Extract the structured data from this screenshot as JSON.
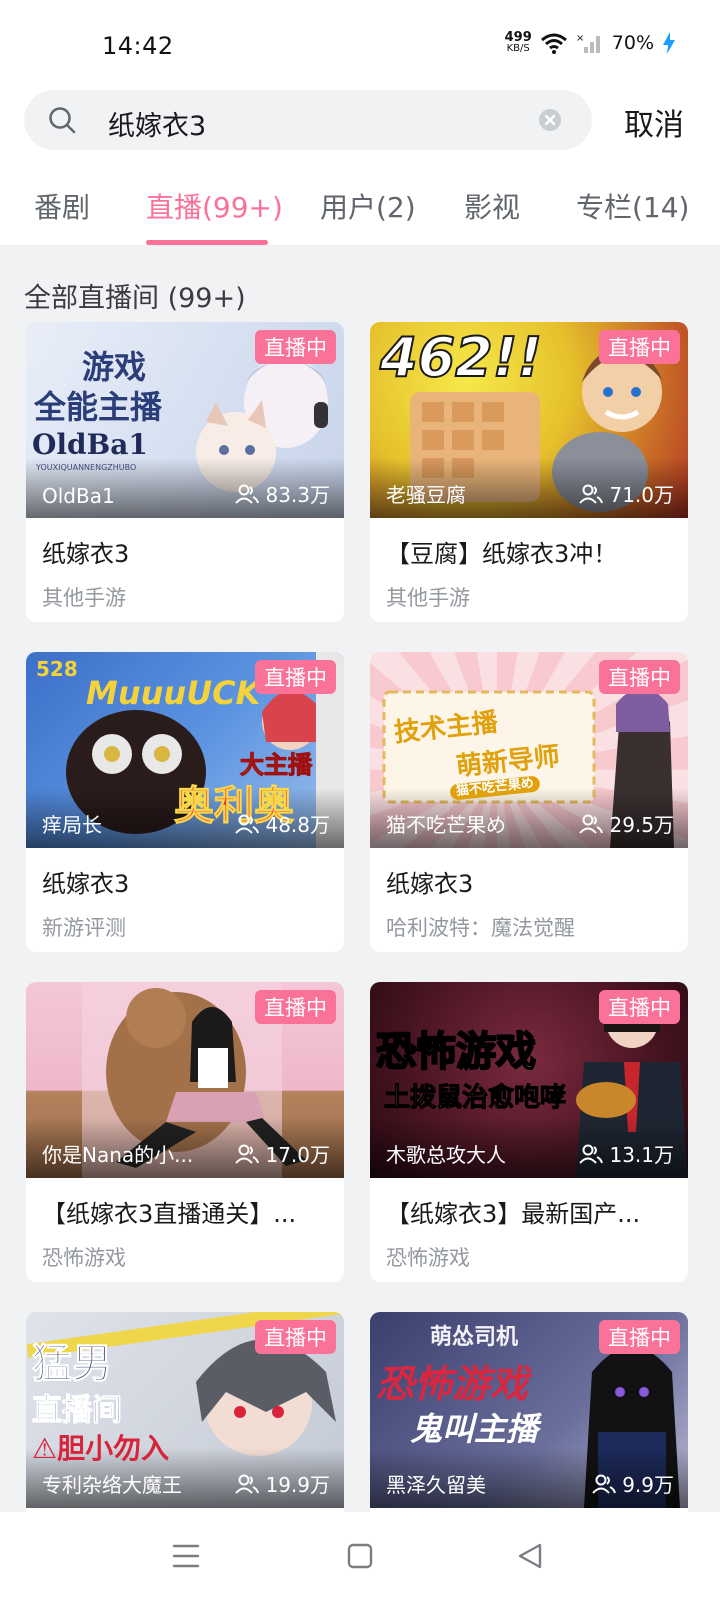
{
  "status": {
    "time": "14:42",
    "speed_value": "499",
    "speed_unit": "KB/S",
    "battery": "70%"
  },
  "search": {
    "query": "纸嫁衣3",
    "cancel_label": "取消"
  },
  "tabs": [
    {
      "label": "番剧"
    },
    {
      "label": "直播(99+)"
    },
    {
      "label": "用户(2)"
    },
    {
      "label": "影视"
    },
    {
      "label": "专栏(14)"
    }
  ],
  "section_title": "全部直播间 (99+)",
  "live_badge": "直播中",
  "cards": [
    {
      "anchor": "OldBa1",
      "viewers": "83.3万",
      "title": "纸嫁衣3",
      "category": "其他手游",
      "thumb_lines": [
        "游戏",
        "全能主播",
        "OldBa1"
      ],
      "thumb_sub": "YOUXIQUANNENGZHUBO"
    },
    {
      "anchor": "老骚豆腐",
      "viewers": "71.0万",
      "title": "【豆腐】纸嫁衣3冲！",
      "category": "其他手游",
      "thumb_lines": [
        "462!!"
      ]
    },
    {
      "anchor": "痒局长",
      "viewers": "48.8万",
      "title": "纸嫁衣3",
      "category": "新游评测",
      "thumb_lines": [
        "528",
        "MuuuUCK",
        "大主播",
        "奥利奥"
      ]
    },
    {
      "anchor": "猫不吃芒果め",
      "viewers": "29.5万",
      "title": "纸嫁衣3",
      "category": "哈利波特：魔法觉醒",
      "thumb_lines": [
        "技术主播",
        "萌新导师",
        "猫不吃芒果め"
      ]
    },
    {
      "anchor": "你是Nana的小...",
      "viewers": "17.0万",
      "title": "【纸嫁衣3直播通关】...",
      "category": "恐怖游戏"
    },
    {
      "anchor": "木歌总攻大人",
      "viewers": "13.1万",
      "title": "【纸嫁衣3】最新国产...",
      "category": "恐怖游戏",
      "thumb_lines": [
        "恐怖游戏",
        "土拨鼠治愈咆哮"
      ]
    },
    {
      "anchor": "专利杂络大魔王",
      "viewers": "19.9万",
      "title": "",
      "category": "",
      "thumb_lines": [
        "猛男",
        "直播间",
        "⚠胆小勿入"
      ]
    },
    {
      "anchor": "黑泽久留美",
      "viewers": "9.9万",
      "title": "",
      "category": "",
      "thumb_lines": [
        "萌怂司机",
        "恐怖游戏",
        "鬼叫主播"
      ]
    }
  ]
}
